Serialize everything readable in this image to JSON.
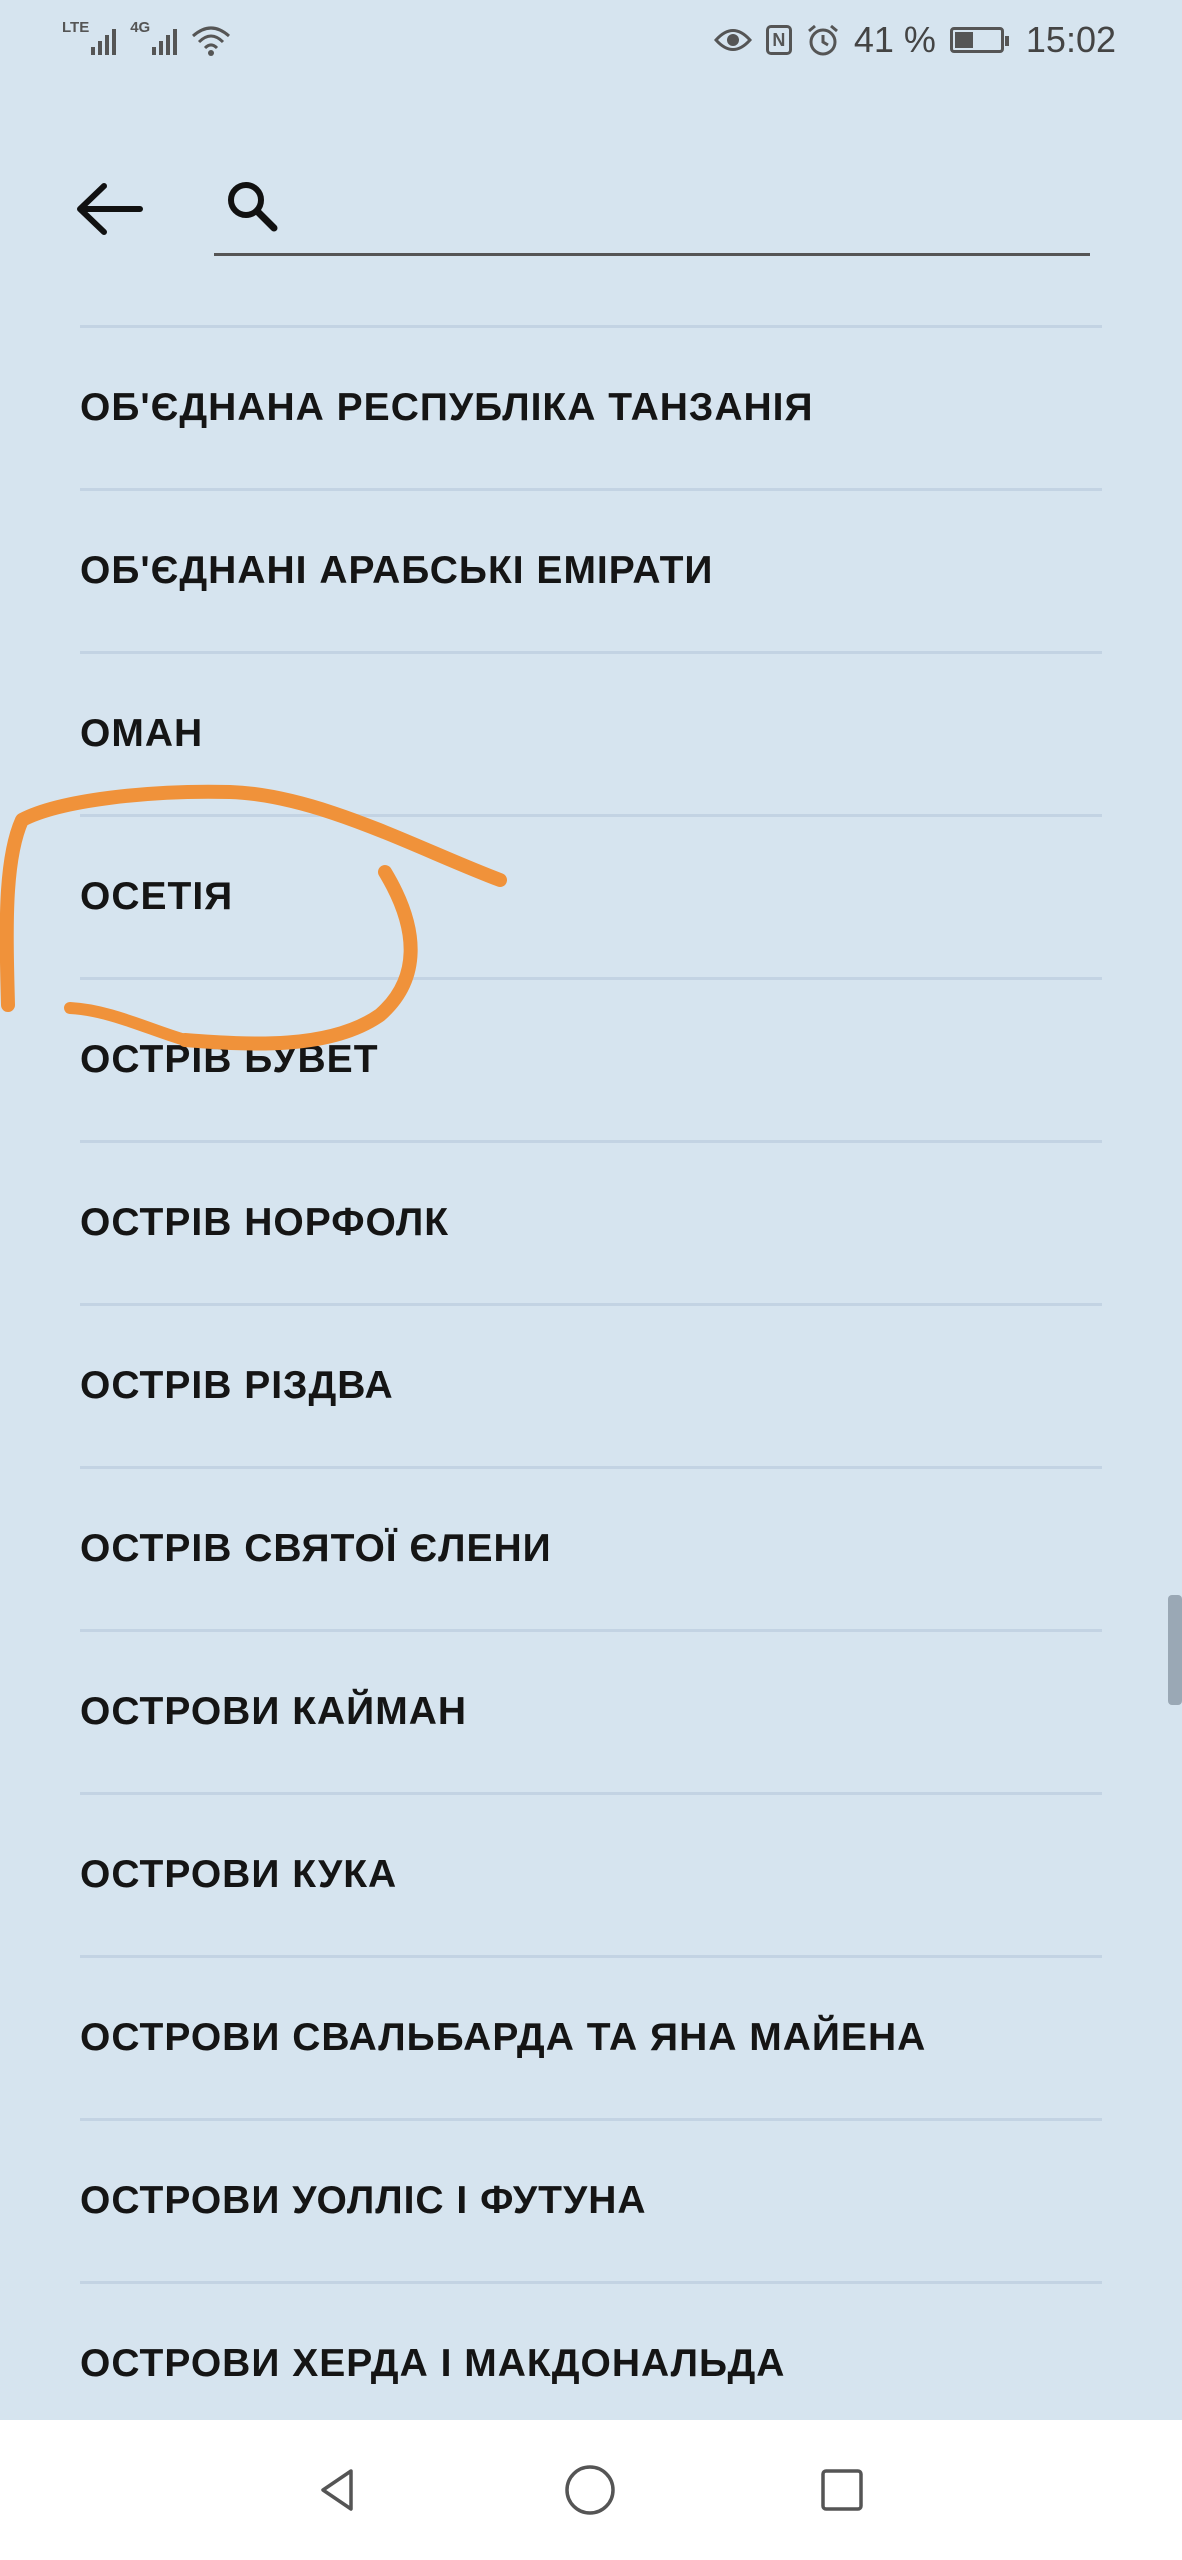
{
  "status_bar": {
    "network_1": "LTE",
    "network_2": "4G",
    "battery_percent": "41 %",
    "battery_level": 0.41,
    "time": "15:02"
  },
  "search": {
    "value": "",
    "placeholder": ""
  },
  "countries": [
    "ОБ'ЄДНАНА РЕСПУБЛІКА ТАНЗАНІЯ",
    "ОБ'ЄДНАНІ АРАБСЬКІ ЕМІРАТИ",
    "ОМАН",
    "ОСЕТІЯ",
    "ОСТРІВ БУВЕТ",
    "ОСТРІВ НОРФОЛК",
    "ОСТРІВ РІЗДВА",
    "ОСТРІВ СВЯТОЇ ЄЛЕНИ",
    "ОСТРОВИ КАЙМАН",
    "ОСТРОВИ КУКА",
    "ОСТРОВИ СВАЛЬБАРДА ТА ЯНА МАЙЕНА",
    "ОСТРОВИ УОЛЛІС І ФУТУНА",
    "ОСТРОВИ ХЕРДА І МАКДОНАЛЬДА"
  ],
  "colors": {
    "background": "#d6e4ef",
    "annotation": "#f0923a",
    "divider": "#c3d3e3"
  }
}
